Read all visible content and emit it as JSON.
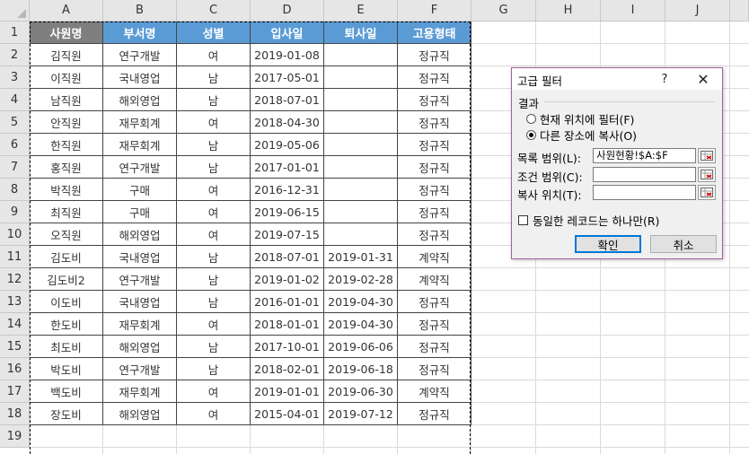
{
  "columns": [
    "A",
    "B",
    "C",
    "D",
    "E",
    "F",
    "G",
    "H",
    "I",
    "J"
  ],
  "row_numbers": [
    "1",
    "2",
    "3",
    "4",
    "5",
    "6",
    "7",
    "8",
    "9",
    "10",
    "11",
    "12",
    "13",
    "14",
    "15",
    "16",
    "17",
    "18",
    "19"
  ],
  "table": {
    "headers": [
      "사원명",
      "부서명",
      "성별",
      "입사일",
      "퇴사일",
      "고용형태"
    ],
    "header_colors": [
      "#7f7f7f",
      "#5b9bd5",
      "#5b9bd5",
      "#5b9bd5",
      "#5b9bd5",
      "#5b9bd5"
    ],
    "rows": [
      [
        "김직원",
        "연구개발",
        "여",
        "2019-01-08",
        "",
        "정규직"
      ],
      [
        "이직원",
        "국내영업",
        "남",
        "2017-05-01",
        "",
        "정규직"
      ],
      [
        "남직원",
        "해외영업",
        "남",
        "2018-07-01",
        "",
        "정규직"
      ],
      [
        "안직원",
        "재무회계",
        "여",
        "2018-04-30",
        "",
        "정규직"
      ],
      [
        "한직원",
        "재무회계",
        "남",
        "2019-05-06",
        "",
        "정규직"
      ],
      [
        "홍직원",
        "연구개발",
        "남",
        "2017-01-01",
        "",
        "정규직"
      ],
      [
        "박직원",
        "구매",
        "여",
        "2016-12-31",
        "",
        "정규직"
      ],
      [
        "최직원",
        "구매",
        "여",
        "2019-06-15",
        "",
        "정규직"
      ],
      [
        "오직원",
        "해외영업",
        "여",
        "2019-07-15",
        "",
        "정규직"
      ],
      [
        "김도비",
        "국내영업",
        "남",
        "2018-07-01",
        "2019-01-31",
        "계약직"
      ],
      [
        "김도비2",
        "연구개발",
        "남",
        "2019-01-02",
        "2019-02-28",
        "계약직"
      ],
      [
        "이도비",
        "국내영업",
        "남",
        "2016-01-01",
        "2019-04-30",
        "정규직"
      ],
      [
        "한도비",
        "재무회계",
        "여",
        "2018-01-01",
        "2019-04-30",
        "정규직"
      ],
      [
        "최도비",
        "해외영업",
        "남",
        "2017-10-01",
        "2019-06-06",
        "정규직"
      ],
      [
        "박도비",
        "연구개발",
        "남",
        "2018-02-01",
        "2019-06-18",
        "정규직"
      ],
      [
        "백도비",
        "재무회계",
        "여",
        "2019-01-01",
        "2019-06-30",
        "계약직"
      ],
      [
        "장도비",
        "해외영업",
        "여",
        "2015-04-01",
        "2019-07-12",
        "정규직"
      ]
    ]
  },
  "dialog": {
    "title": "고급 필터",
    "help": "?",
    "close": "✕",
    "result_label": "결과",
    "radio_in_place": "현재 위치에 필터(F)",
    "radio_copy": "다른 장소에 복사(O)",
    "selected_radio": "copy",
    "list_range_label": "목록 범위(L):",
    "list_range_value": "사원현황!$A:$F",
    "criteria_range_label": "조건 범위(C):",
    "criteria_range_value": "",
    "copy_to_label": "복사 위치(T):",
    "copy_to_value": "",
    "unique_label": "동일한 레코드는 하나만(R)",
    "unique_checked": false,
    "ok_label": "확인",
    "cancel_label": "취소"
  }
}
